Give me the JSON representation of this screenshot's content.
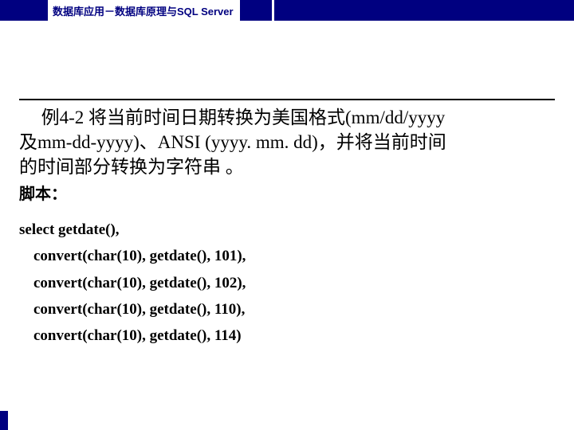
{
  "header": {
    "title": "数据库应用－数据库原理与SQL Server"
  },
  "problem": {
    "line1_prefix": "例4-2",
    "line1_rest": "  将当前时间日期转换为美国格式(mm/dd/yyyy",
    "line2": "及mm-dd-yyyy)、ANSI (yyyy. mm. dd)，并将当前时间",
    "line3": "的时间部分转换为字符串 。"
  },
  "script_label": "脚本：",
  "code": {
    "line1": "select getdate(),",
    "line2": "convert(char(10), getdate(), 101),",
    "line3": "convert(char(10), getdate(), 102),",
    "line4": "convert(char(10), getdate(), 110),",
    "line5": "convert(char(10), getdate(), 114)"
  }
}
